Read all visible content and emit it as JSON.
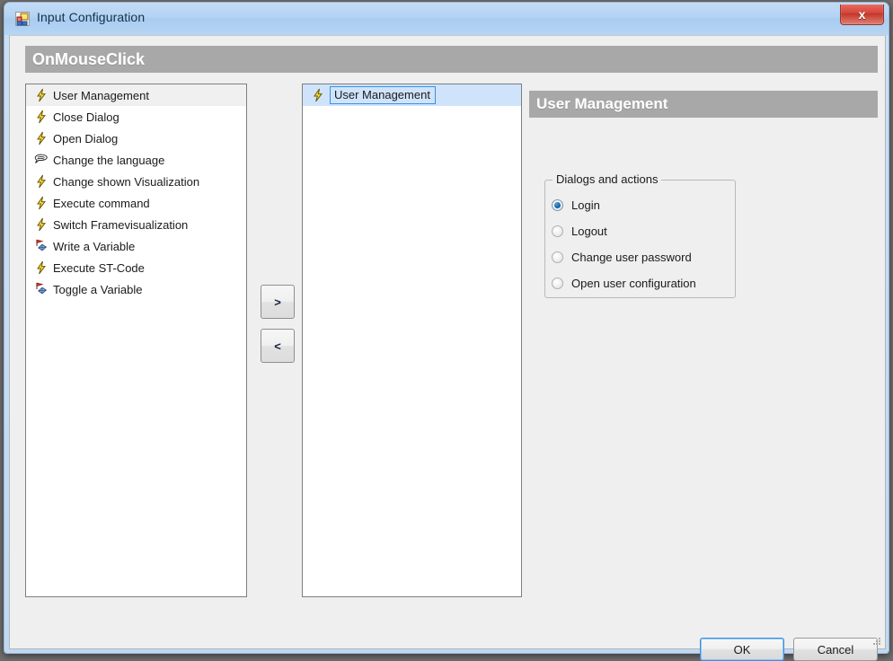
{
  "window": {
    "title": "Input Configuration",
    "icon": "form-designer-icon",
    "close_label": "x"
  },
  "main_header": {
    "title": "OnMouseClick"
  },
  "available_list": {
    "items": [
      {
        "label": "User Management",
        "icon": "lightning-icon",
        "state": "selected"
      },
      {
        "label": "Close Dialog",
        "icon": "lightning-icon",
        "state": "normal"
      },
      {
        "label": "Open Dialog",
        "icon": "lightning-icon",
        "state": "normal"
      },
      {
        "label": "Change the language",
        "icon": "speech-bubble-icon",
        "state": "normal"
      },
      {
        "label": "Change shown Visualization",
        "icon": "lightning-icon",
        "state": "normal"
      },
      {
        "label": "Execute command",
        "icon": "lightning-icon",
        "state": "normal"
      },
      {
        "label": "Switch Framevisualization",
        "icon": "lightning-icon",
        "state": "normal"
      },
      {
        "label": "Write a Variable",
        "icon": "variable-write-icon",
        "state": "normal"
      },
      {
        "label": "Execute ST-Code",
        "icon": "lightning-icon",
        "state": "normal"
      },
      {
        "label": "Toggle a Variable",
        "icon": "variable-toggle-icon",
        "state": "normal"
      }
    ]
  },
  "selected_list": {
    "items": [
      {
        "label": "User Management",
        "icon": "lightning-icon",
        "state": "editing"
      }
    ]
  },
  "transfer_buttons": {
    "move_right": ">",
    "move_left": "<"
  },
  "detail_panel": {
    "header": "User Management",
    "group_title": "Dialogs and actions",
    "options": [
      {
        "label": "Login",
        "checked": true
      },
      {
        "label": "Logout",
        "checked": false
      },
      {
        "label": "Change user password",
        "checked": false
      },
      {
        "label": "Open user configuration",
        "checked": false
      }
    ]
  },
  "footer": {
    "ok_label": "OK",
    "cancel_label": "Cancel"
  },
  "colors": {
    "header_bar": "#a8a8a8",
    "accent_blue": "#3c8fe0",
    "selection_blue": "#cfe4fb",
    "title_bar": "#b3d2f2",
    "close_red": "#d3483c",
    "client_bg": "#efefef"
  }
}
